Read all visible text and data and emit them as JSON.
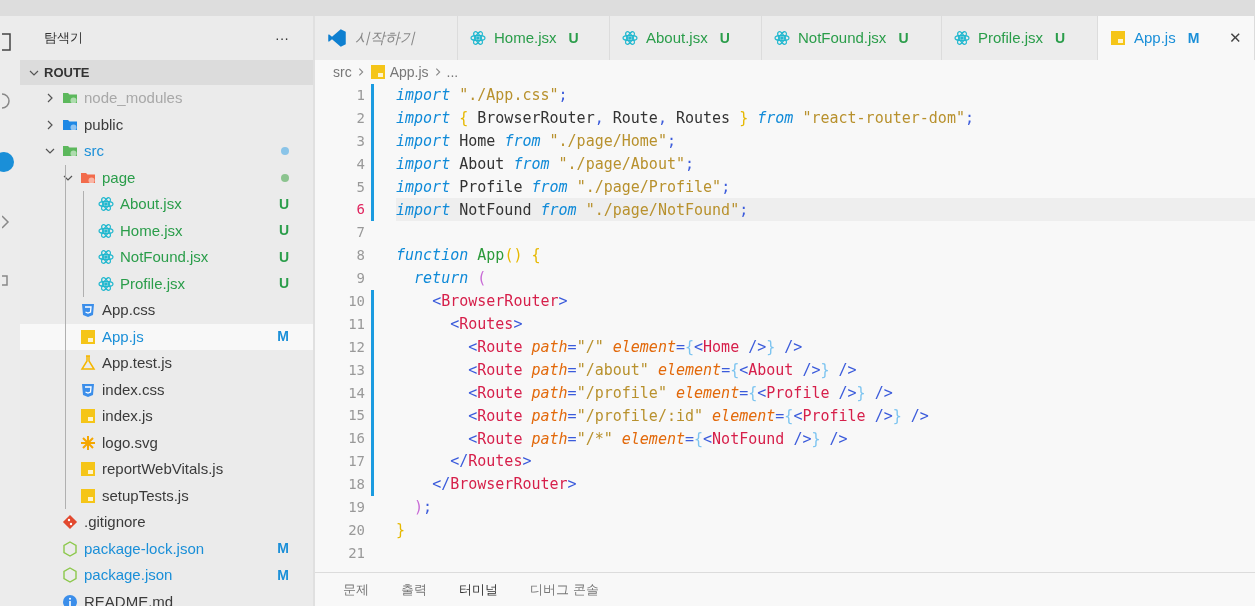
{
  "explorer": {
    "title": "탐색기",
    "more": "···",
    "root": "ROUTE",
    "root_expanded": true,
    "tree": [
      {
        "name": "node_modules",
        "kind": "folder",
        "expanded": false,
        "dimmed": true,
        "selected": false
      },
      {
        "name": "public",
        "kind": "folder",
        "expanded": false,
        "dimmed": false,
        "selected": false
      },
      {
        "name": "src",
        "kind": "folder",
        "expanded": true,
        "dimmed": false,
        "color": "#8ac4e8",
        "selected": false,
        "children": [
          {
            "name": "page",
            "kind": "folder",
            "expanded": true,
            "dimmed": false,
            "color": "#8cc48f",
            "selected": false,
            "children": [
              {
                "name": "About.jsx",
                "kind": "react",
                "badge": "U",
                "selected": false
              },
              {
                "name": "Home.jsx",
                "kind": "react",
                "badge": "U",
                "selected": false
              },
              {
                "name": "NotFound.jsx",
                "kind": "react",
                "badge": "U",
                "selected": false
              },
              {
                "name": "Profile.jsx",
                "kind": "react",
                "badge": "U",
                "selected": false
              }
            ]
          },
          {
            "name": "App.css",
            "kind": "css",
            "selected": false
          },
          {
            "name": "App.js",
            "kind": "js",
            "badge": "M",
            "selected": true
          },
          {
            "name": "App.test.js",
            "kind": "test",
            "selected": false
          },
          {
            "name": "index.css",
            "kind": "css",
            "selected": false
          },
          {
            "name": "index.js",
            "kind": "js",
            "selected": false
          },
          {
            "name": "logo.svg",
            "kind": "svg",
            "selected": false
          },
          {
            "name": "reportWebVitals.js",
            "kind": "js",
            "selected": false
          },
          {
            "name": "setupTests.js",
            "kind": "js",
            "selected": false
          }
        ]
      },
      {
        "name": ".gitignore",
        "kind": "git",
        "selected": false
      },
      {
        "name": "package-lock.json",
        "kind": "json",
        "badge": "M",
        "selected": false
      },
      {
        "name": "package.json",
        "kind": "json",
        "badge": "M",
        "selected": false
      },
      {
        "name": "README.md",
        "kind": "readme",
        "selected": false
      }
    ]
  },
  "tabs": [
    {
      "label": "시작하기",
      "kind": "welcome",
      "selected": false,
      "preview": true
    },
    {
      "label": "Home.jsx",
      "kind": "react",
      "badge": "U",
      "selected": false,
      "preview": false
    },
    {
      "label": "About.jsx",
      "kind": "react",
      "badge": "U",
      "selected": false,
      "preview": false
    },
    {
      "label": "NotFound.jsx",
      "kind": "react",
      "badge": "U",
      "selected": false,
      "preview": false
    },
    {
      "label": "Profile.jsx",
      "kind": "react",
      "badge": "U",
      "selected": false,
      "preview": false
    },
    {
      "label": "App.js",
      "kind": "js",
      "badge": "M",
      "selected": true,
      "preview": false,
      "close": "✕"
    }
  ],
  "breadcrumb": [
    {
      "label": "src"
    },
    {
      "label": "App.js",
      "kind": "js"
    },
    {
      "label": "..."
    }
  ],
  "code": [
    {
      "number": "1",
      "modified": true,
      "current": false,
      "text": "import \"./App.css\";"
    },
    {
      "number": "2",
      "modified": true,
      "current": false,
      "text": "import { BrowserRouter, Route, Routes } from \"react-router-dom\";"
    },
    {
      "number": "3",
      "modified": true,
      "current": false,
      "text": "import Home from \"./page/Home\";"
    },
    {
      "number": "4",
      "modified": true,
      "current": false,
      "text": "import About from \"./page/About\";"
    },
    {
      "number": "5",
      "modified": true,
      "current": false,
      "text": "import Profile from \"./page/Profile\";"
    },
    {
      "number": "6",
      "modified": true,
      "current": true,
      "text": "import NotFound from \"./page/NotFound\";"
    },
    {
      "number": "7",
      "modified": false,
      "current": false
    },
    {
      "number": "8",
      "modified": false,
      "current": false,
      "text": "function App() {"
    },
    {
      "number": "9",
      "modified": false,
      "current": false,
      "text": "  return ("
    },
    {
      "number": "10",
      "modified": true,
      "current": false,
      "text": "    <BrowserRouter>"
    },
    {
      "number": "11",
      "modified": true,
      "current": false,
      "text": "      <Routes>"
    },
    {
      "number": "12",
      "modified": true,
      "current": false,
      "text": "        <Route path=\"/\" element={<Home />} />"
    },
    {
      "number": "13",
      "modified": true,
      "current": false,
      "text": "        <Route path=\"/about\" element={<About />} />"
    },
    {
      "number": "14",
      "modified": true,
      "current": false,
      "text": "        <Route path=\"/profile\" element={<Profile />} />"
    },
    {
      "number": "15",
      "modified": true,
      "current": false,
      "text": "        <Route path=\"/profile/:id\" element={<Profile />} />"
    },
    {
      "number": "16",
      "modified": true,
      "current": false,
      "text": "        <Route path=\"/*\" element={<NotFound />} />"
    },
    {
      "number": "17",
      "modified": true,
      "current": false,
      "text": "      </Routes>"
    },
    {
      "number": "18",
      "modified": true,
      "current": false,
      "text": "    </BrowserRouter>"
    },
    {
      "number": "19",
      "modified": false,
      "current": false,
      "text": "  );"
    },
    {
      "number": "20",
      "modified": false,
      "current": false,
      "text": "}"
    },
    {
      "number": "21",
      "modified": false,
      "current": false
    }
  ],
  "panel_tabs": [
    {
      "label": "문제",
      "selected": false
    },
    {
      "label": "출력",
      "selected": false
    },
    {
      "label": "터미널",
      "selected": true
    },
    {
      "label": "디버그 콘솔",
      "selected": false
    }
  ]
}
